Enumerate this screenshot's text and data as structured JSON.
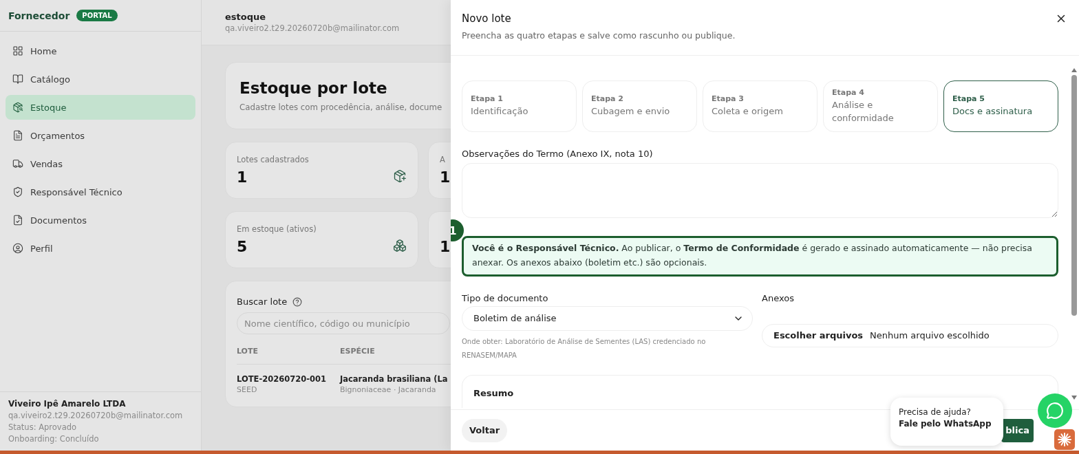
{
  "sidebar": {
    "brand": "Fornecedor",
    "badge": "PORTAL",
    "items": [
      {
        "label": "Home",
        "selected": false
      },
      {
        "label": "Catálogo",
        "selected": false
      },
      {
        "label": "Estoque",
        "selected": true
      },
      {
        "label": "Orçamentos",
        "selected": false
      },
      {
        "label": "Vendas",
        "selected": false
      },
      {
        "label": "Responsável Técnico",
        "selected": false
      },
      {
        "label": "Documentos",
        "selected": false
      },
      {
        "label": "Perfil",
        "selected": false
      }
    ],
    "account": {
      "name": "Viveiro Ipê Amarelo LTDA",
      "email": "qa.viveiro2.t29.20260720b@mailinator.com",
      "status": "Status: Aprovado",
      "onboarding": "Onboarding: Concluído"
    }
  },
  "header": {
    "title": "estoque",
    "email": "qa.viveiro2.t29.20260720b@mailinator.com"
  },
  "hero": {
    "title": "Estoque por lote",
    "subtitle": "Cadastre lotes com procedência, análise, docume"
  },
  "stats": [
    {
      "label": "Lotes cadastrados",
      "value": "1"
    },
    {
      "label": "A",
      "value": "1"
    },
    {
      "label": "Em estoque (ativos)",
      "value": "5"
    },
    {
      "value": "1"
    }
  ],
  "search": {
    "label": "Buscar lote",
    "placeholder": "Nome científico, código ou município",
    "table": {
      "columns": [
        "LOTE",
        "ESPÉCIE"
      ],
      "rows": [
        {
          "code": "LOTE-20260720-001",
          "type": "SEED",
          "species": "Jacaranda brasiliana (La",
          "family": "Bignoniaceae · Jacaranda"
        }
      ]
    }
  },
  "modal": {
    "title": "Novo lote",
    "subtitle": "Preencha as quatro etapas e salve como rascunho ou publique.",
    "steps": [
      {
        "step": "Etapa 1",
        "label": "Identificação",
        "selected": false
      },
      {
        "step": "Etapa 2",
        "label": "Cubagem e envio",
        "selected": false
      },
      {
        "step": "Etapa 3",
        "label": "Coleta e origem",
        "selected": false
      },
      {
        "step": "Etapa 4",
        "label": "Análise e conformidade",
        "selected": false
      },
      {
        "step": "Etapa 5",
        "label": "Docs e assinatura",
        "selected": true
      }
    ],
    "notes_label": "Observações do Termo (Anexo IX, nota 10)",
    "info": "**Você é o Responsável Técnico.** Ao publicar, o **Termo de Conformidade** é gerado e assinado automaticamente — não precisa anexar. Os anexos abaixo (boletim etc.) são opcionais.",
    "annotation": "1",
    "doc_type": {
      "label": "Tipo de documento",
      "value": "Boletim de análise",
      "hint": "Onde obter: Laboratório de Análise de Sementes (LAS) credenciado no RENASEM/MAPA"
    },
    "attachments": {
      "label": "Anexos",
      "button": "Escolher arquivos",
      "status": "Nenhum arquivo escolhido"
    },
    "summary": "Resumo",
    "back": "Voltar",
    "publish": "blica"
  },
  "help": {
    "line1": "Precisa de ajuda?",
    "line2": "Fale pelo WhatsApp"
  }
}
